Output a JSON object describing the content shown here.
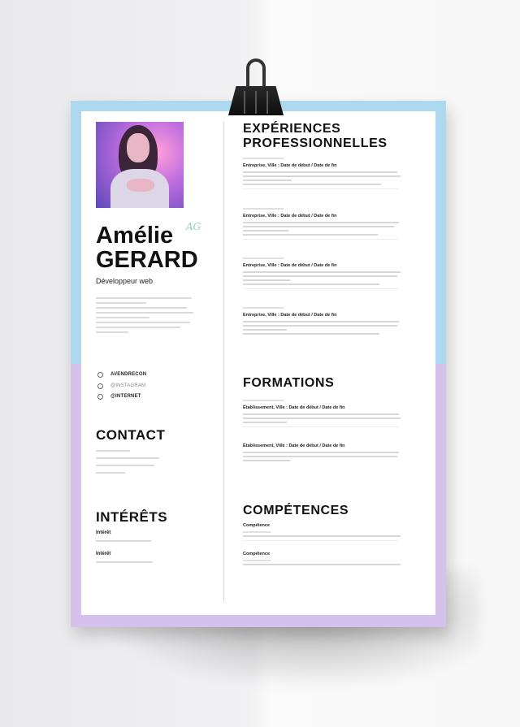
{
  "resume": {
    "name_first": "Amélie",
    "name_last": "GERARD",
    "job_title": "Développeur web",
    "signature": "AG",
    "contact_links": [
      {
        "icon": "globe-icon",
        "text": "AVENDRECON"
      },
      {
        "icon": "phone-icon",
        "text": "@INSTAGRAM"
      },
      {
        "icon": "link-icon",
        "text": "@INTERNET"
      }
    ],
    "contact_heading": "CONTACT",
    "interests_heading": "INTÉRÊTS",
    "interests": [
      {
        "label": "Intérêt"
      },
      {
        "label": "Intérêt"
      }
    ],
    "experience_heading_line1": "EXPÉRIENCES",
    "experience_heading_line2": "PROFESSIONNELLES",
    "experiences": [
      {
        "title": "Entreprise, Ville : Date de début / Date de fin"
      },
      {
        "title": "Entreprise, Ville : Date de début / Date de fin"
      },
      {
        "title": "Entreprise, Ville : Date de début / Date de fin"
      },
      {
        "title": "Entreprise, Ville : Date de début / Date de fin"
      }
    ],
    "education_heading": "FORMATIONS",
    "education": [
      {
        "title": "Établissement, Ville : Date de début / Date de fin"
      },
      {
        "title": "Établissement, Ville : Date de début / Date de fin"
      }
    ],
    "skills_heading": "COMPÉTENCES",
    "skills": [
      {
        "label": "Compétence"
      },
      {
        "label": "Compétence"
      }
    ]
  },
  "colors": {
    "frame_top": "#acd8f0",
    "frame_bottom": "#d6c1ec",
    "signature_accent": "#8ed4b2"
  }
}
